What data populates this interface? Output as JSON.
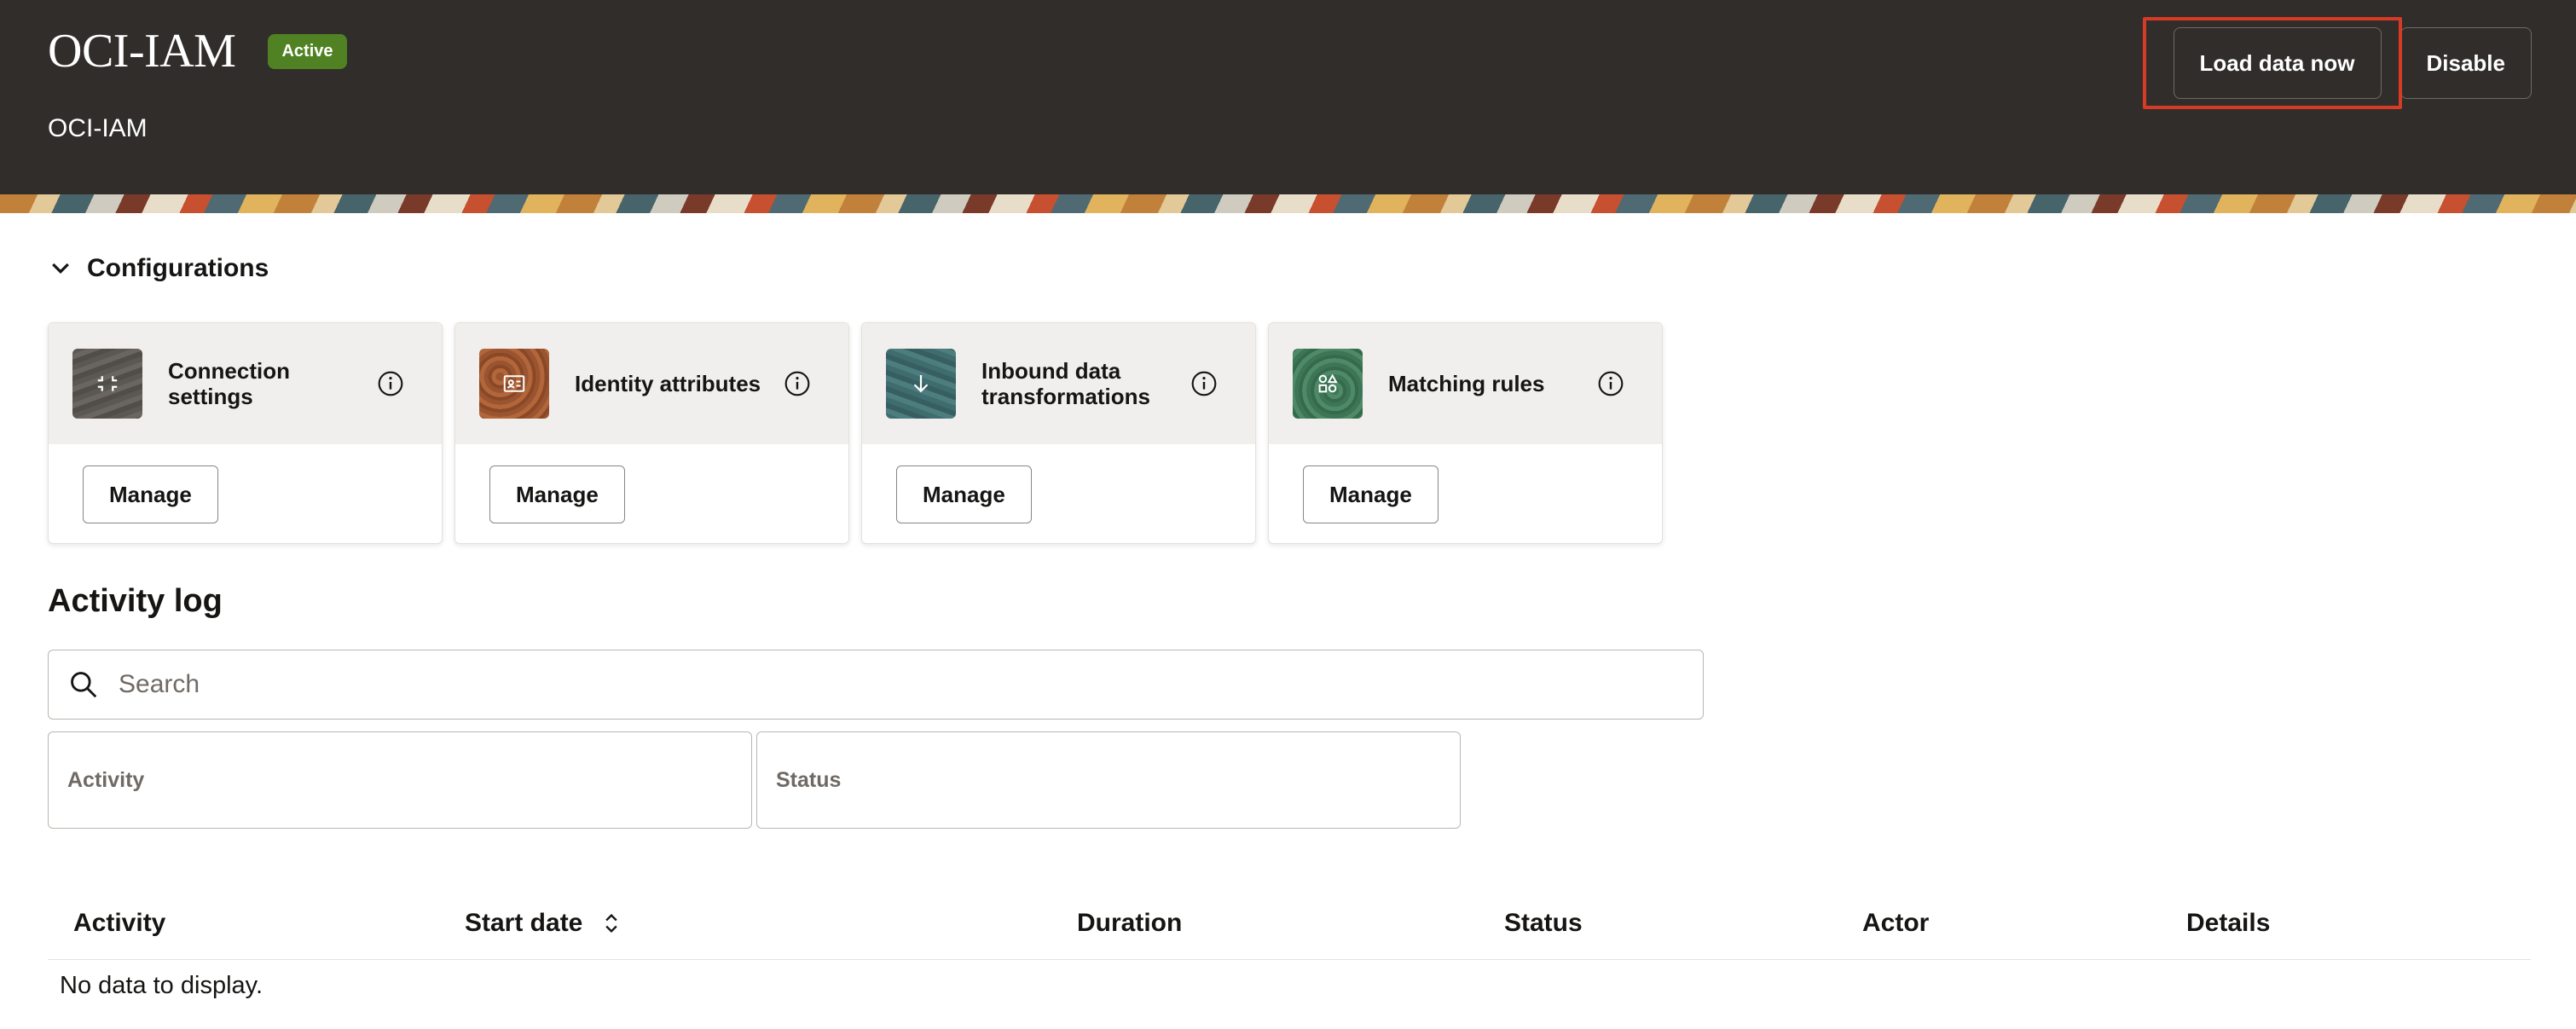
{
  "header": {
    "title": "OCI-IAM",
    "status_badge": "Active",
    "subtitle": "OCI-IAM",
    "load_button": "Load data now",
    "disable_button": "Disable"
  },
  "configurations": {
    "section_title": "Configurations",
    "cards": [
      {
        "label": "Connection settings",
        "manage": "Manage",
        "icon": "connection-icon"
      },
      {
        "label": "Identity attributes",
        "manage": "Manage",
        "icon": "id-card-icon"
      },
      {
        "label": "Inbound data transformations",
        "manage": "Manage",
        "icon": "arrow-down-icon"
      },
      {
        "label": "Matching rules",
        "manage": "Manage",
        "icon": "shapes-icon"
      }
    ]
  },
  "activity_log": {
    "title": "Activity log",
    "search_placeholder": "Search",
    "filters": {
      "activity": "Activity",
      "status": "Status"
    },
    "columns": [
      "Activity",
      "Start date",
      "Duration",
      "Status",
      "Actor",
      "Details"
    ],
    "empty_message": "No data to display."
  },
  "colors": {
    "header_bg": "#312d2a",
    "badge_green": "#508223",
    "highlight_red": "#d63b25"
  }
}
